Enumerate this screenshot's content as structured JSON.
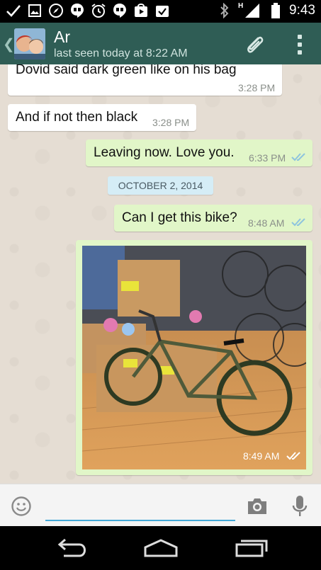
{
  "status_bar": {
    "time": "9:43",
    "network_type": "H",
    "icons_left": [
      "check-icon",
      "image-icon",
      "compass-icon",
      "hangouts-icon",
      "alarm-icon",
      "hangouts-icon",
      "play-store-icon",
      "download-done-icon"
    ],
    "icons_right": [
      "bluetooth-icon",
      "signal-icon",
      "battery-icon"
    ]
  },
  "header": {
    "contact_name": "Ar",
    "last_seen": "last seen today at 8:22 AM",
    "background_color": "#2f5d55"
  },
  "messages": [
    {
      "direction": "in",
      "text": "Dovid said dark green like on his bag",
      "time": "3:28 PM"
    },
    {
      "direction": "in",
      "text": "And if not then black",
      "time": "3:28 PM"
    },
    {
      "direction": "out",
      "text": "Leaving now. Love you.",
      "time": "6:33 PM",
      "read": true
    },
    {
      "direction": "out",
      "text": "Can I get this bike?",
      "time": "8:48 AM",
      "read": true
    },
    {
      "direction": "out",
      "type": "image",
      "time": "8:49 AM",
      "read": true
    }
  ],
  "date_divider": "OCTOBER 2, 2014",
  "composer": {
    "placeholder": ""
  },
  "colors": {
    "outgoing_bubble": "#e1f6c8",
    "incoming_bubble": "#ffffff",
    "chat_background": "#e5ddd3",
    "read_ticks": "#8ec4de"
  }
}
